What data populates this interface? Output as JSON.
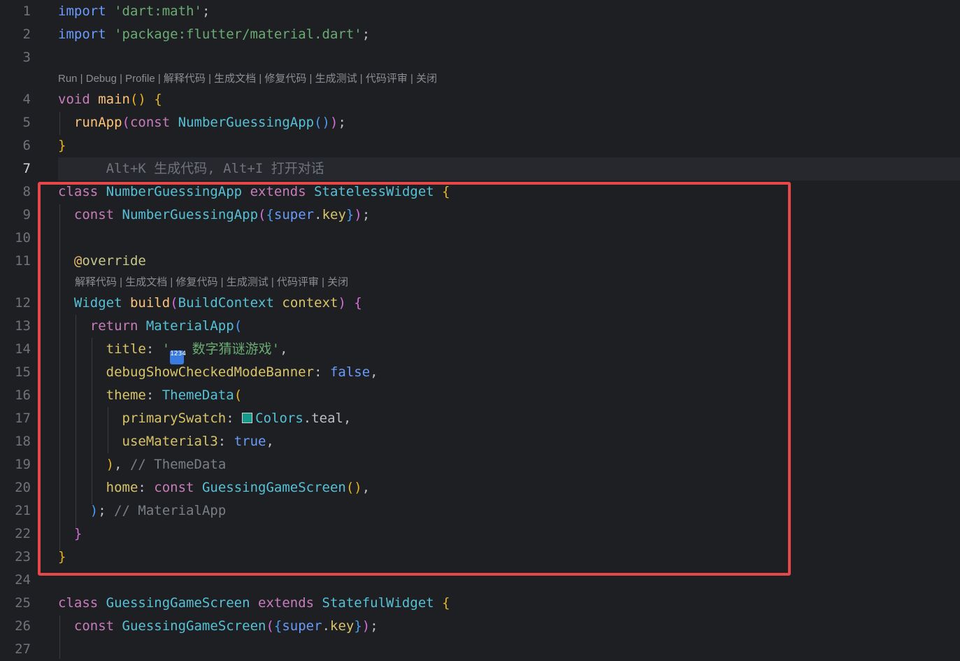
{
  "editor": {
    "line_numbers": [
      "1",
      "2",
      "3",
      "4",
      "5",
      "6",
      "7",
      "8",
      "9",
      "10",
      "11",
      "12",
      "13",
      "14",
      "15",
      "16",
      "17",
      "18",
      "19",
      "20",
      "21",
      "22",
      "23",
      "24",
      "25",
      "26",
      "27"
    ],
    "lens_main": "Run | Debug | Profile | 解释代码 | 生成文档 | 修复代码 | 生成测试 | 代码评审 | 关闭",
    "lens_build": "解释代码 | 生成文档 | 修复代码 | 生成测试 | 代码评审 | 关闭",
    "inline_hint": "Alt+K 生成代码, Alt+I 打开对话",
    "code": {
      "l1": [
        "import",
        "'dart:math'",
        ";"
      ],
      "l2": [
        "import",
        "'package:flutter/material.dart'",
        ";"
      ],
      "l4": [
        "void",
        "main",
        "()",
        "{"
      ],
      "l5": [
        "runApp",
        "(",
        "const",
        "NumberGuessingApp",
        "()",
        ")",
        ";"
      ],
      "l6": [
        "}"
      ],
      "l8": [
        "class",
        "NumberGuessingApp",
        "extends",
        "StatelessWidget",
        "{"
      ],
      "l9": [
        "const",
        "NumberGuessingApp",
        "(",
        "{",
        "super",
        ".",
        "key",
        "}",
        ")",
        ";"
      ],
      "l11": [
        "@",
        "override"
      ],
      "l12": [
        "Widget",
        "build",
        "(",
        "BuildContext",
        "context",
        ")",
        "{"
      ],
      "l13": [
        "return",
        "MaterialApp",
        "("
      ],
      "l14": [
        "title",
        ": ",
        "'",
        "数字猜谜游戏'",
        ","
      ],
      "l15": [
        "debugShowCheckedModeBanner",
        ": ",
        "false",
        ","
      ],
      "l16": [
        "theme",
        ": ",
        "ThemeData",
        "("
      ],
      "l17": [
        "primarySwatch",
        ": ",
        "Colors",
        ".",
        "teal",
        ","
      ],
      "l18": [
        "useMaterial3",
        ": ",
        "true",
        ","
      ],
      "l19": [
        ")",
        ", ",
        "// ThemeData"
      ],
      "l20": [
        "home",
        ": ",
        "const",
        "GuessingGameScreen",
        "()",
        ","
      ],
      "l21": [
        ")",
        "; ",
        "// MaterialApp"
      ],
      "l22": [
        "}"
      ],
      "l23": [
        "}"
      ],
      "l25": [
        "class",
        "GuessingGameScreen",
        "extends",
        "StatefulWidget",
        "{"
      ],
      "l26": [
        "const",
        "GuessingGameScreen",
        "(",
        "{",
        "super",
        ".",
        "key",
        "}",
        ")",
        ";"
      ]
    },
    "emoji_glyph": "1234",
    "colors": {
      "background": "#1e1f22",
      "highlight_box": "#e54849",
      "swatch_teal": "#159a8a"
    }
  }
}
